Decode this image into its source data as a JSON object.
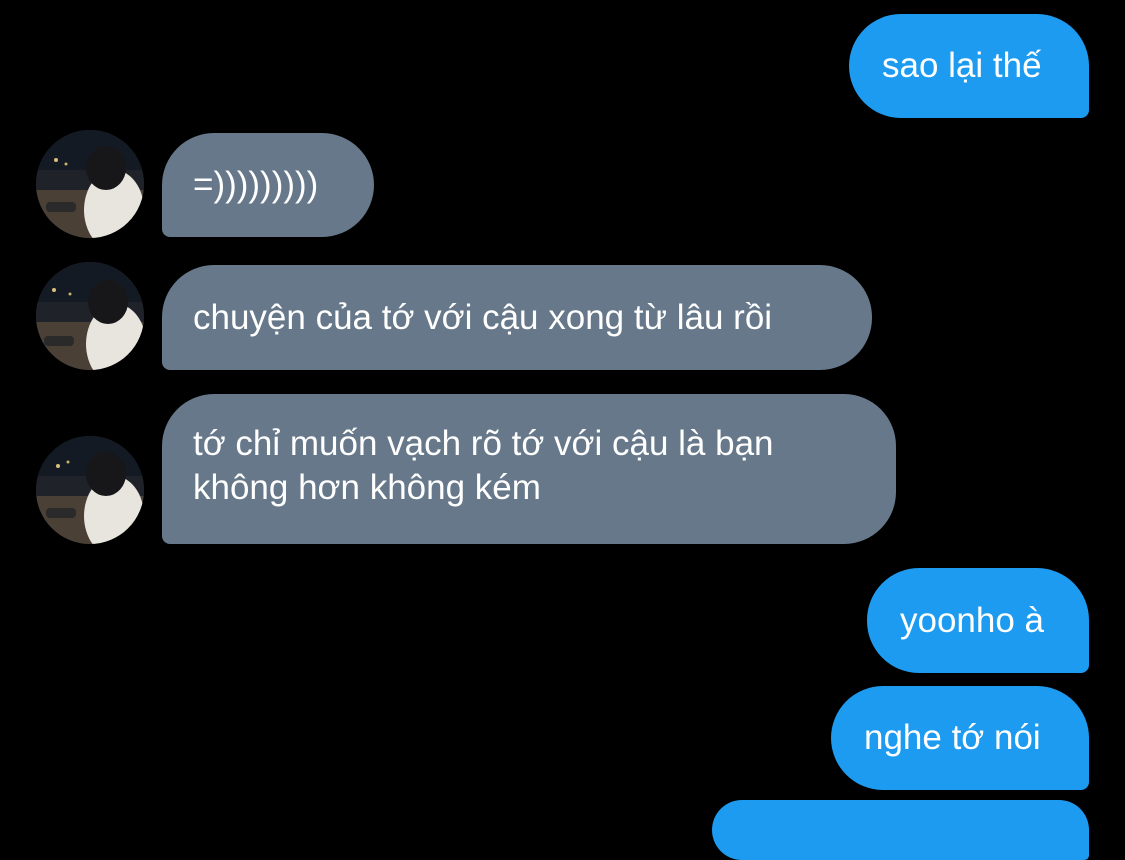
{
  "colors": {
    "background": "#000000",
    "sent_bubble": "#1d9bf0",
    "received_bubble": "#66788a",
    "text": "#ffffff"
  },
  "messages": [
    {
      "direction": "sent",
      "text": "sao lại thế"
    },
    {
      "direction": "received",
      "text": "=)))))))))"
    },
    {
      "direction": "received",
      "text": "chuyện của tớ với cậu xong từ lâu rồi"
    },
    {
      "direction": "received",
      "lines": [
        "tớ chỉ muốn vạch rõ tớ với cậu là bạn",
        "không hơn không kém"
      ]
    },
    {
      "direction": "sent",
      "text": "yoonho à"
    },
    {
      "direction": "sent",
      "text": "nghe tớ nói"
    }
  ],
  "avatar": {
    "icon": "user-photo-avatar"
  }
}
